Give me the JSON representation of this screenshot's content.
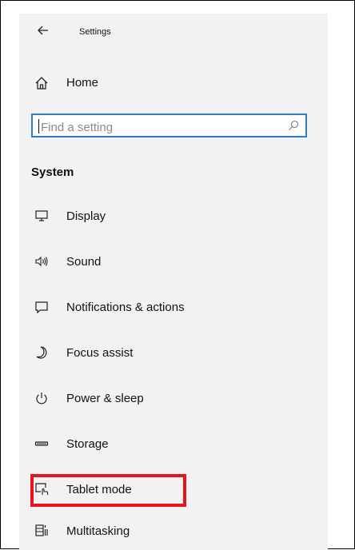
{
  "window": {
    "title": "Settings",
    "back_icon": "back-arrow-icon"
  },
  "home": {
    "label": "Home",
    "icon": "home-icon"
  },
  "search": {
    "placeholder": "Find a setting",
    "value": "",
    "icon": "search-icon",
    "border_color": "#2f7cc6"
  },
  "section": {
    "heading": "System"
  },
  "nav": {
    "items": [
      {
        "label": "Display",
        "icon": "display-icon"
      },
      {
        "label": "Sound",
        "icon": "sound-icon"
      },
      {
        "label": "Notifications & actions",
        "icon": "notifications-icon"
      },
      {
        "label": "Focus assist",
        "icon": "moon-icon"
      },
      {
        "label": "Power & sleep",
        "icon": "power-icon"
      },
      {
        "label": "Storage",
        "icon": "storage-icon"
      },
      {
        "label": "Tablet mode",
        "icon": "tablet-mode-icon"
      },
      {
        "label": "Multitasking",
        "icon": "multitasking-icon"
      }
    ]
  },
  "annotation": {
    "highlighted_item": "Tablet mode",
    "highlight_color": "#e8141b"
  }
}
